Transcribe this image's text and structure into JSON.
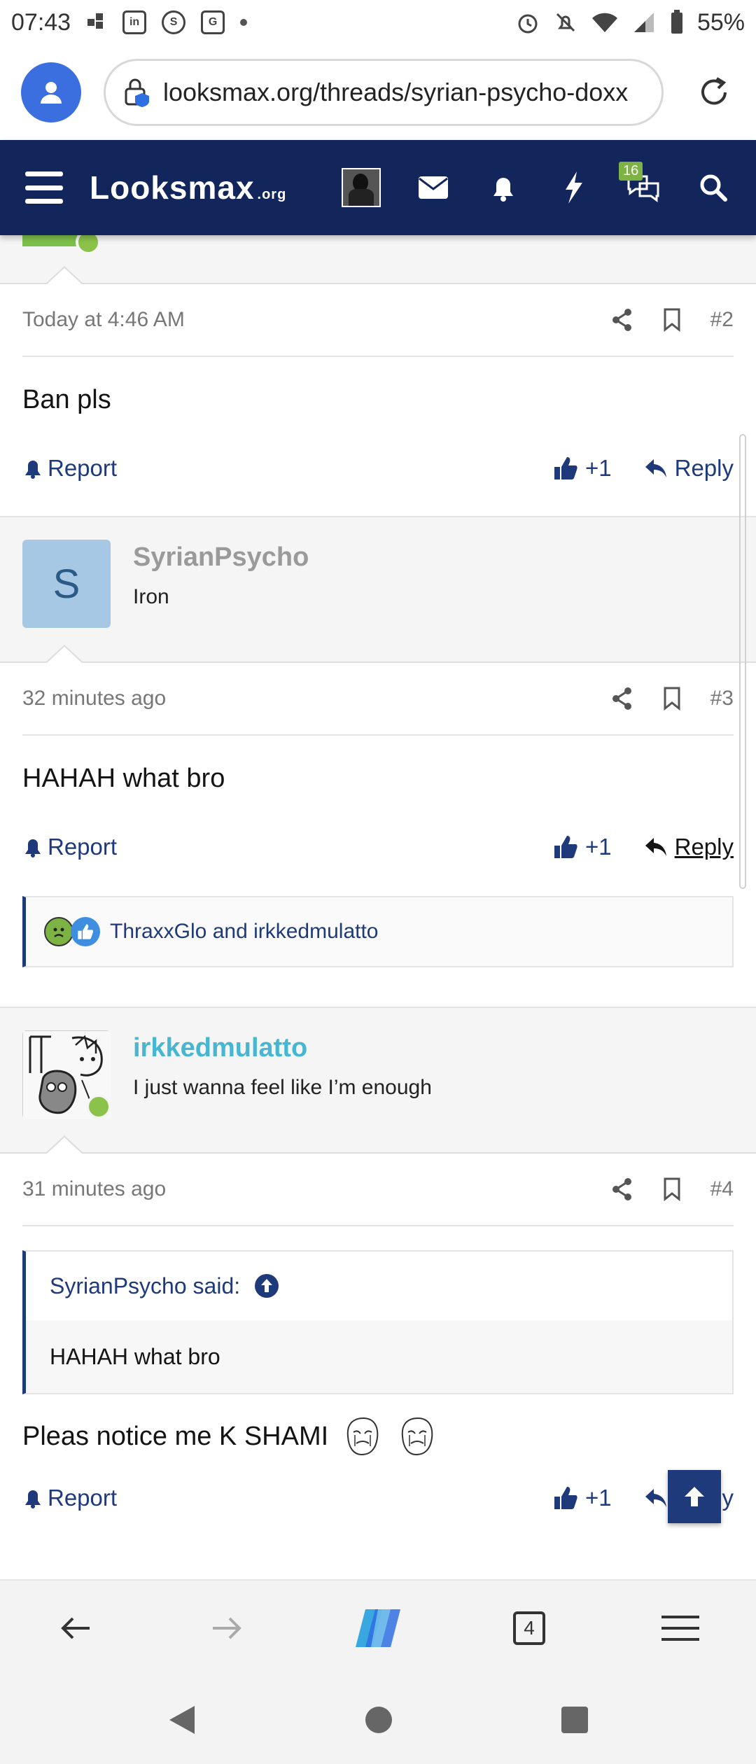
{
  "status_bar": {
    "time": "07:43",
    "battery": "55%",
    "notification_icons": [
      "grid-icon",
      "linkedin-icon",
      "news-icon",
      "ge-icon",
      "dot-icon"
    ]
  },
  "browser": {
    "url": "looksmax.org/threads/syrian-psycho-doxx",
    "tab_count": "4"
  },
  "site": {
    "logo_main": "Looksmax",
    "logo_suffix": ".org",
    "conversations_badge": "16"
  },
  "posts": [
    {
      "date": "Today at 4:46 AM",
      "number": "#2",
      "message": "Ban pls",
      "report_label": "Report",
      "like_label": "+1",
      "reply_label": "Reply"
    },
    {
      "author": "SyrianPsycho",
      "author_initial": "S",
      "author_title": "Iron",
      "date": "32 minutes ago",
      "number": "#3",
      "message": "HAHAH what bro",
      "report_label": "Report",
      "like_label": "+1",
      "reply_label": "Reply",
      "reactions_text": "ThraxxGlo and irkkedmulatto"
    },
    {
      "author": "irkkedmulatto",
      "author_title": "I just wanna feel like I’m enough",
      "date": "31 minutes ago",
      "number": "#4",
      "quote_author": "SyrianPsycho said:",
      "quote_text": "HAHAH what bro",
      "message": "Pleas notice me K SHAMI",
      "report_label": "Report",
      "like_label": "+1",
      "reply_label": "Reply"
    }
  ],
  "colors": {
    "nav_bg": "#13265c",
    "link": "#1e3a7a",
    "username_teal": "#47b6d0",
    "username_gray": "#9a9a9a",
    "online": "#8bc34a",
    "avatar_s_bg": "#a7c8e4"
  }
}
